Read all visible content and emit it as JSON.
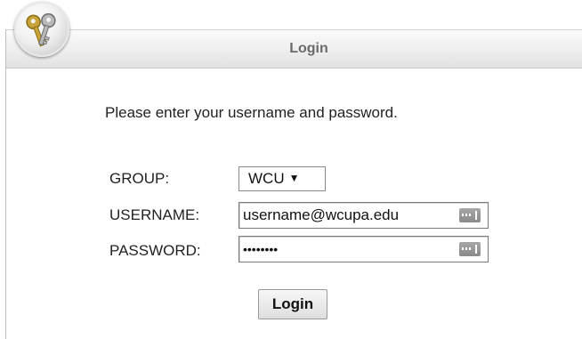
{
  "panel": {
    "title": "Login",
    "badge_icon": "keys-icon"
  },
  "form": {
    "prompt": "Please enter your username and password.",
    "group": {
      "label": "GROUP:",
      "selected": "WCU",
      "arrow": "▼"
    },
    "username": {
      "label": "USERNAME:",
      "value": "username@wcupa.edu"
    },
    "password": {
      "label": "PASSWORD:",
      "value": "••••••••"
    },
    "submit_label": "Login"
  },
  "colors": {
    "title_text": "#6a6a6a",
    "body_text": "#222222",
    "field_border": "#7a7a7a"
  }
}
